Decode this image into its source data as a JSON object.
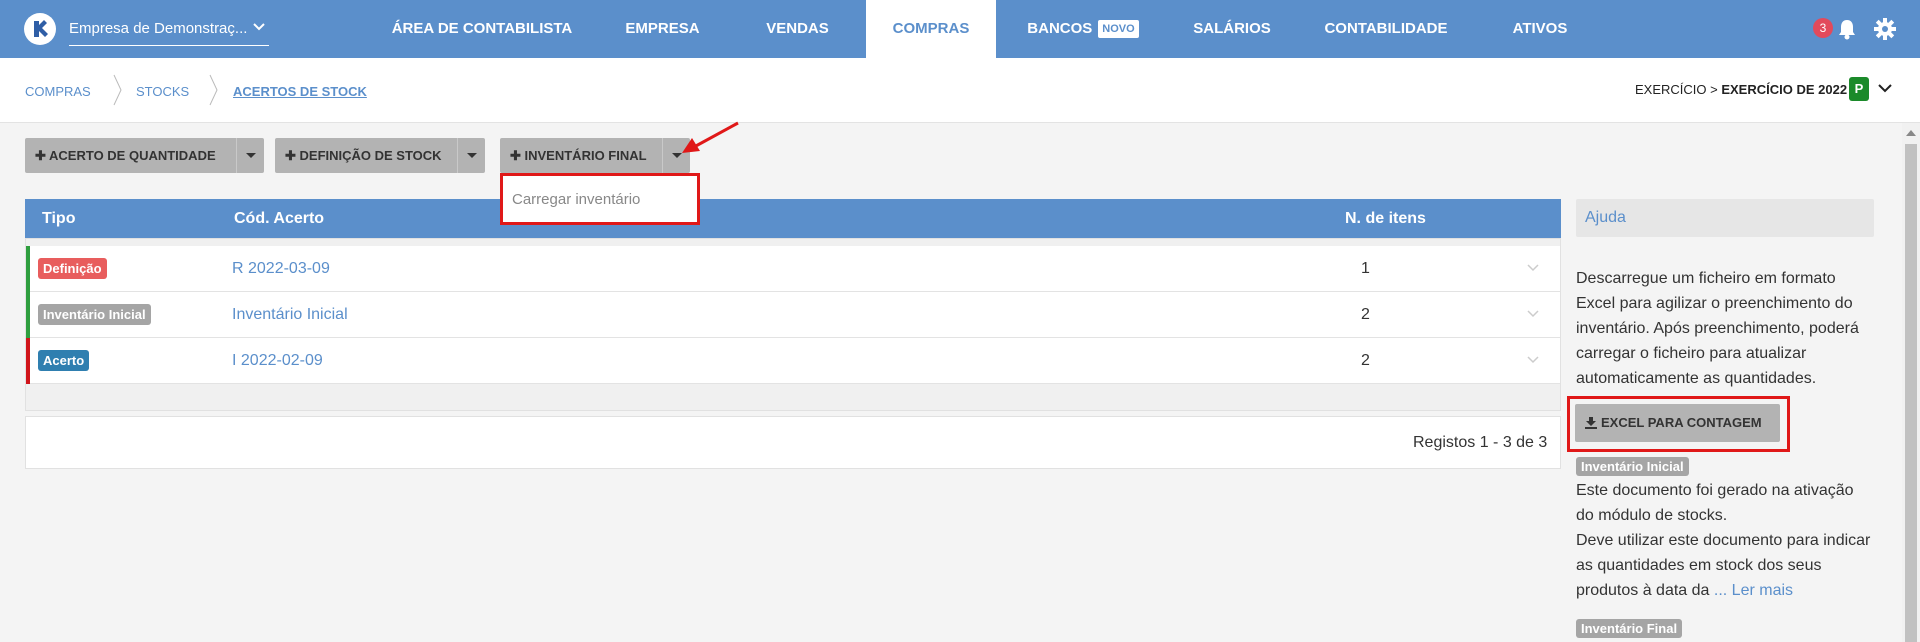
{
  "topbar": {
    "company": "Empresa de Demonstraç...",
    "nav": [
      {
        "label": "ÁREA DE CONTABILISTA",
        "active": false
      },
      {
        "label": "EMPRESA",
        "active": false
      },
      {
        "label": "VENDAS",
        "active": false
      },
      {
        "label": "COMPRAS",
        "active": true
      },
      {
        "label": "BANCOS",
        "active": false,
        "badge": "NOVO"
      },
      {
        "label": "SALÁRIOS",
        "active": false
      },
      {
        "label": "CONTABILIDADE",
        "active": false
      },
      {
        "label": "ATIVOS",
        "active": false
      }
    ],
    "notifications": "3",
    "color": "#5b8fcb"
  },
  "breadcrumb": {
    "items": [
      "COMPRAS",
      "STOCKS",
      "ACERTOS DE STOCK"
    ]
  },
  "exercicio": {
    "prefix": "EXERCÍCIO > ",
    "value": "EXERCÍCIO DE 2022",
    "badge": "P"
  },
  "toolbar": {
    "btn1": "ACERTO DE QUANTIDADE",
    "btn2": "DEFINIÇÃO DE STOCK",
    "btn3": "INVENTÁRIO FINAL",
    "dropdown_item": "Carregar inventário"
  },
  "table": {
    "headers": {
      "tipo": "Tipo",
      "codigo": "Cód. Acerto",
      "itens": "N. de itens"
    },
    "rows": [
      {
        "tipo": "Definição",
        "tipo_color": "#e85d5d",
        "bar_color": "#2e9e3e",
        "codigo": "R 2022-03-09",
        "itens": "1"
      },
      {
        "tipo": "Inventário Inicial",
        "tipo_color": "#a5a5a5",
        "bar_color": "#2e9e3e",
        "codigo": "Inventário Inicial",
        "itens": "2"
      },
      {
        "tipo": "Acerto",
        "tipo_color": "#2f7fb0",
        "bar_color": "#d0141a",
        "codigo": "I 2022-02-09",
        "itens": "2"
      }
    ],
    "footer": "Registos 1 - 3 de 3"
  },
  "help": {
    "title": "Ajuda",
    "intro": [
      "Descarregue um ficheiro em formato",
      "Excel para agilizar o preenchimento do",
      "inventário. Após preenchimento, poderá",
      "carregar o ficheiro para atualizar",
      "automaticamente as quantidades."
    ],
    "excel_button": "EXCEL PARA CONTAGEM",
    "tag1": "Inventário Inicial",
    "body": [
      "Este documento foi gerado na ativação",
      "do módulo de stocks.",
      "Deve utilizar este documento para indicar",
      "as quantidades em stock dos seus",
      "produtos à data da"
    ],
    "ellipsis": " ... ",
    "read_more": "Ler mais",
    "tag2": "Inventário Final"
  }
}
